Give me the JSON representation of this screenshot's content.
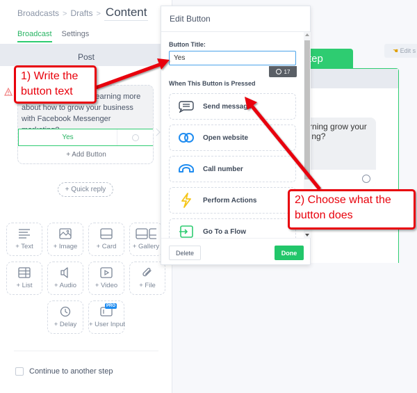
{
  "breadcrumb": {
    "items": [
      "Broadcasts",
      "Drafts"
    ],
    "current": "Content",
    "separator": ">"
  },
  "tabs": [
    {
      "label": "Broadcast",
      "active": true
    },
    {
      "label": "Settings",
      "active": false
    }
  ],
  "post_bar": {
    "label": "Post"
  },
  "message": {
    "text": "Are you interested in learning more about how to grow your business with Facebook Messenger marketing?",
    "visible_text": "rning more about how to grow your business with Facebook Messenger marketing?",
    "button_label": "Yes",
    "add_button_label": "+ Add Button"
  },
  "quick_reply": {
    "label": "+ Quick reply"
  },
  "content_tiles": [
    {
      "label": "+ Text",
      "icon": "text-lines-icon"
    },
    {
      "label": "+ Image",
      "icon": "image-icon"
    },
    {
      "label": "+ Card",
      "icon": "card-icon"
    },
    {
      "label": "+ Gallery",
      "icon": "gallery-icon"
    },
    {
      "label": "+ List",
      "icon": "list-icon"
    },
    {
      "label": "+ Audio",
      "icon": "audio-icon"
    },
    {
      "label": "+ Video",
      "icon": "video-icon"
    },
    {
      "label": "+ File",
      "icon": "paperclip-icon"
    },
    {
      "label": "+ Delay",
      "icon": "clock-icon"
    },
    {
      "label": "+ User Input",
      "icon": "user-input-icon",
      "badge": "PRO"
    }
  ],
  "continue": {
    "label": "Continue to another step",
    "checked": false
  },
  "canvas": {
    "step_tab_label": "Step",
    "edit_label": "Edit s",
    "message_text": "n learning grow your book ng?"
  },
  "modal": {
    "title": "Edit Button",
    "button_title_label": "Button Title:",
    "button_title_value": "Yes",
    "char_count": "17",
    "section_label": "When This Button is Pressed",
    "actions": [
      {
        "label": "Send message",
        "icon": "chat-bubble-icon",
        "color": "#3f4a5a"
      },
      {
        "label": "Open website",
        "icon": "link-icon",
        "color": "#1f8cf0"
      },
      {
        "label": "Call number",
        "icon": "phone-icon",
        "color": "#1f8cf0"
      },
      {
        "label": "Perform Actions",
        "icon": "lightning-icon",
        "color": "#f5c518"
      },
      {
        "label": "Go To a Flow",
        "icon": "flow-enter-icon",
        "color": "#2ecc71"
      }
    ],
    "delete_label": "Delete",
    "done_label": "Done"
  },
  "annotations": [
    {
      "text": "1) Write the button text"
    },
    {
      "text": "2) Choose what the button does"
    }
  ],
  "colors": {
    "accent_green": "#2ecc71",
    "link_blue": "#1f8cf0",
    "annotation_red": "#e8000b"
  }
}
